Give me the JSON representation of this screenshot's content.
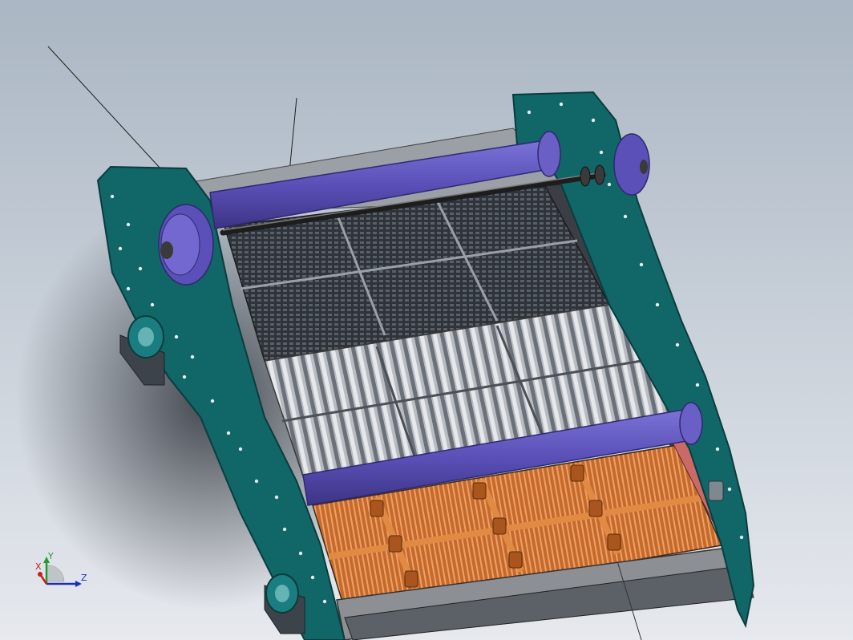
{
  "viewport": {
    "background_top": "#aab6c3",
    "background_bottom": "#e6e9ee"
  },
  "colors": {
    "frame": "#116668",
    "frame_dark": "#0b4d4f",
    "roller": "#6a5fc4",
    "roller_dark": "#4a3f96",
    "top_deck": "#3f444b",
    "mid_deck": "#c3c7cc",
    "bottom_deck": "#d07a3a",
    "trough": "#8c8f93",
    "red_edge": "#c96a68"
  },
  "triad": {
    "y_label": "Y",
    "x_label": "X",
    "z_label": "Z",
    "y_color": "#1f9e2f",
    "x_color": "#c81e1e",
    "z_color": "#1e2fb4"
  }
}
